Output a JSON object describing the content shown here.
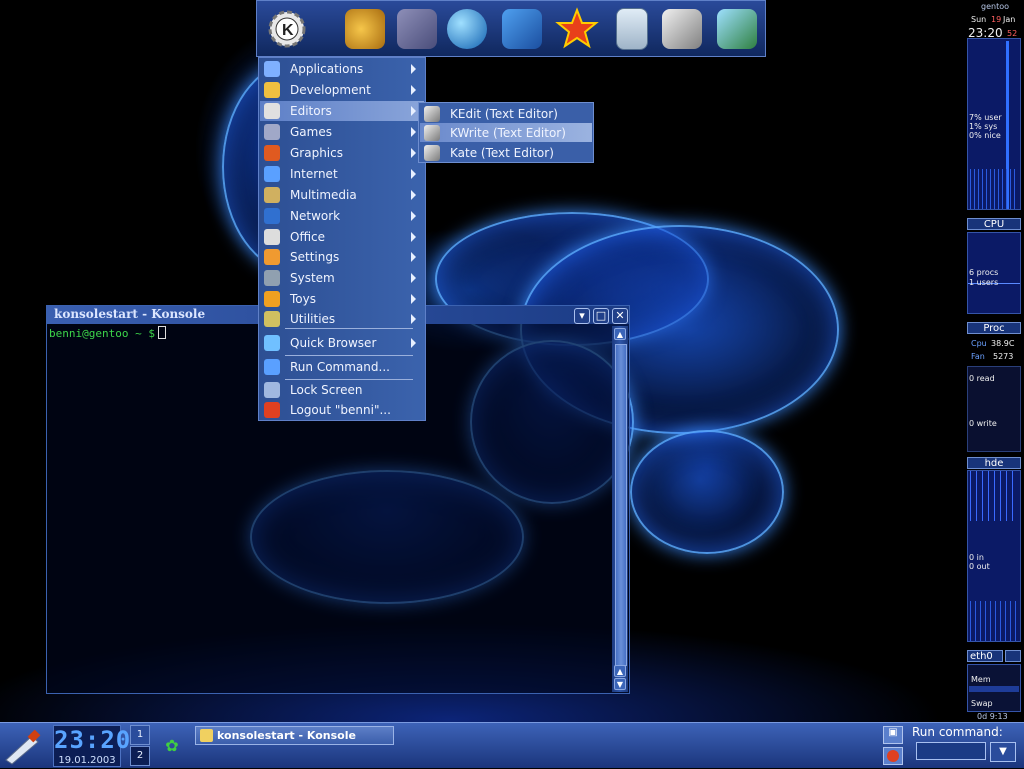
{
  "kicker": {
    "buttons": [
      {
        "name": "kde-menu-button",
        "icon": "kde-gear-icon",
        "color": "#f0f0f0"
      },
      {
        "name": "gimp-button",
        "icon": "gimp-icon",
        "color": "#e0a020"
      },
      {
        "name": "galeon-button",
        "icon": "galeon-icon",
        "color": "#6b6f9c"
      },
      {
        "name": "web-browser-button",
        "icon": "globe-icon",
        "color": "#3da0e0"
      },
      {
        "name": "pen-editor-button",
        "icon": "fountain-pen-icon",
        "color": "#3b7fd8"
      },
      {
        "name": "star-app-button",
        "icon": "star-fox-icon",
        "color": "#e83a1a"
      },
      {
        "name": "calculator-button",
        "icon": "calculator-icon",
        "color": "#c8d8e8"
      },
      {
        "name": "text-editor-button",
        "icon": "pen-nib-icon",
        "color": "#d0d0d0"
      },
      {
        "name": "system-info-button",
        "icon": "computer-icon",
        "color": "#40c060"
      }
    ]
  },
  "kmenu": {
    "items": [
      {
        "label": "Applications",
        "icon": "applications-icon",
        "arrow": true
      },
      {
        "label": "Development",
        "icon": "development-icon",
        "arrow": true
      },
      {
        "label": "Editors",
        "icon": "editors-icon",
        "arrow": true,
        "highlighted": true
      },
      {
        "label": "Games",
        "icon": "games-icon",
        "arrow": true
      },
      {
        "label": "Graphics",
        "icon": "graphics-icon",
        "arrow": true
      },
      {
        "label": "Internet",
        "icon": "internet-icon",
        "arrow": true
      },
      {
        "label": "Multimedia",
        "icon": "multimedia-icon",
        "arrow": true
      },
      {
        "label": "Network",
        "icon": "network-icon",
        "arrow": true
      },
      {
        "label": "Office",
        "icon": "office-icon",
        "arrow": true
      },
      {
        "label": "Settings",
        "icon": "settings-icon",
        "arrow": true
      },
      {
        "label": "System",
        "icon": "system-icon",
        "arrow": true
      },
      {
        "label": "Toys",
        "icon": "toys-icon",
        "arrow": true
      },
      {
        "label": "Utilities",
        "icon": "utilities-icon",
        "arrow": true
      },
      {
        "label": "Quick Browser",
        "icon": "quick-browser-icon",
        "arrow": true
      },
      {
        "label": "Run Command...",
        "icon": "run-command-icon",
        "arrow": false
      },
      {
        "label": "Lock Screen",
        "icon": "lock-icon",
        "arrow": false
      },
      {
        "label": "Logout \"benni\"...",
        "icon": "logout-icon",
        "arrow": false
      }
    ]
  },
  "submenu": {
    "items": [
      {
        "label": "KEdit (Text Editor)",
        "icon": "kedit-icon"
      },
      {
        "label": "KWrite (Text Editor)",
        "icon": "kwrite-icon",
        "highlighted": true
      },
      {
        "label": "Kate (Text Editor)",
        "icon": "kate-icon"
      }
    ]
  },
  "konsole": {
    "title": "konsolestart - Konsole",
    "prompt": "benni@gentoo ~ $"
  },
  "monitor": {
    "hostname": "gentoo",
    "date_day": "Sun",
    "date_num": "19",
    "date_month": "Jan",
    "time": "23:20",
    "seconds": "52",
    "cpu_user": "7% user",
    "cpu_sys": "1% sys",
    "cpu_nice": "0% nice",
    "cpu_label": "CPU",
    "procs": "6 procs",
    "users": "1 users",
    "proc_label": "Proc",
    "cpu_temp_label": "Cpu",
    "cpu_temp": "38.9C",
    "fan_label": "Fan",
    "fan_rpm": "5273",
    "disk_read": "0 read",
    "disk_write": "0 write",
    "disk_label": "hde",
    "net_in": "0 in",
    "net_out": "0 out",
    "net_label": "eth0",
    "mem_label": "Mem",
    "swap_label": "Swap",
    "uptime": "0d 9:13"
  },
  "panel": {
    "clock_time": "23:20",
    "clock_date": "19.01.2003",
    "pager": [
      "1",
      "2"
    ],
    "task": "konsolestart - Konsole",
    "run_label": "Run command:"
  }
}
